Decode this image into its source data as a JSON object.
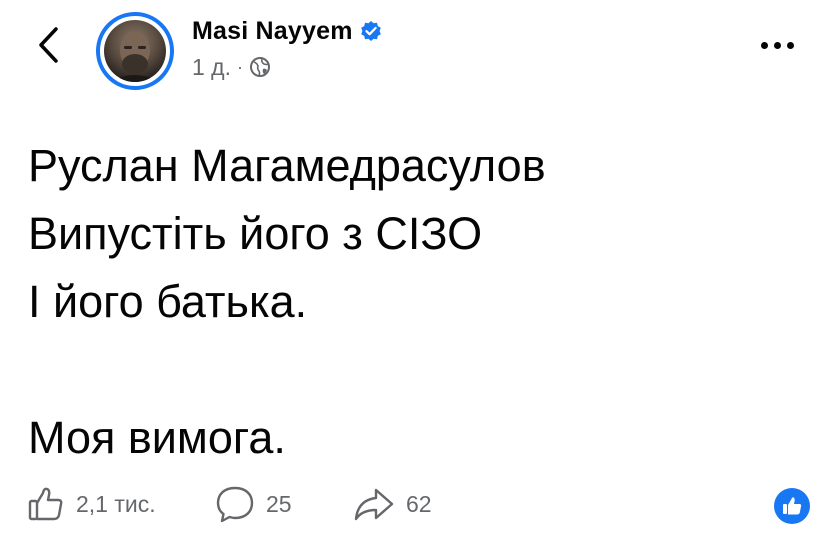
{
  "post": {
    "author": "Masi Nayyem",
    "verified": true,
    "time": "1 д.",
    "separator": "·",
    "audience_icon": "globe-icon",
    "body_lines": [
      "Руслан Магамедрасулов",
      "Випустіть його з СІЗО",
      "І його батька.",
      "",
      "Моя вимога."
    ]
  },
  "actions": {
    "likes": "2,1 тис.",
    "comments": "25",
    "shares": "62"
  },
  "colors": {
    "accent": "#1877f2",
    "muted": "#65676b",
    "text": "#050505"
  },
  "icons": [
    "chevron-left-icon",
    "verified-badge-icon",
    "globe-icon",
    "more-icon",
    "like-icon",
    "comment-icon",
    "share-icon",
    "like-reaction-icon"
  ]
}
